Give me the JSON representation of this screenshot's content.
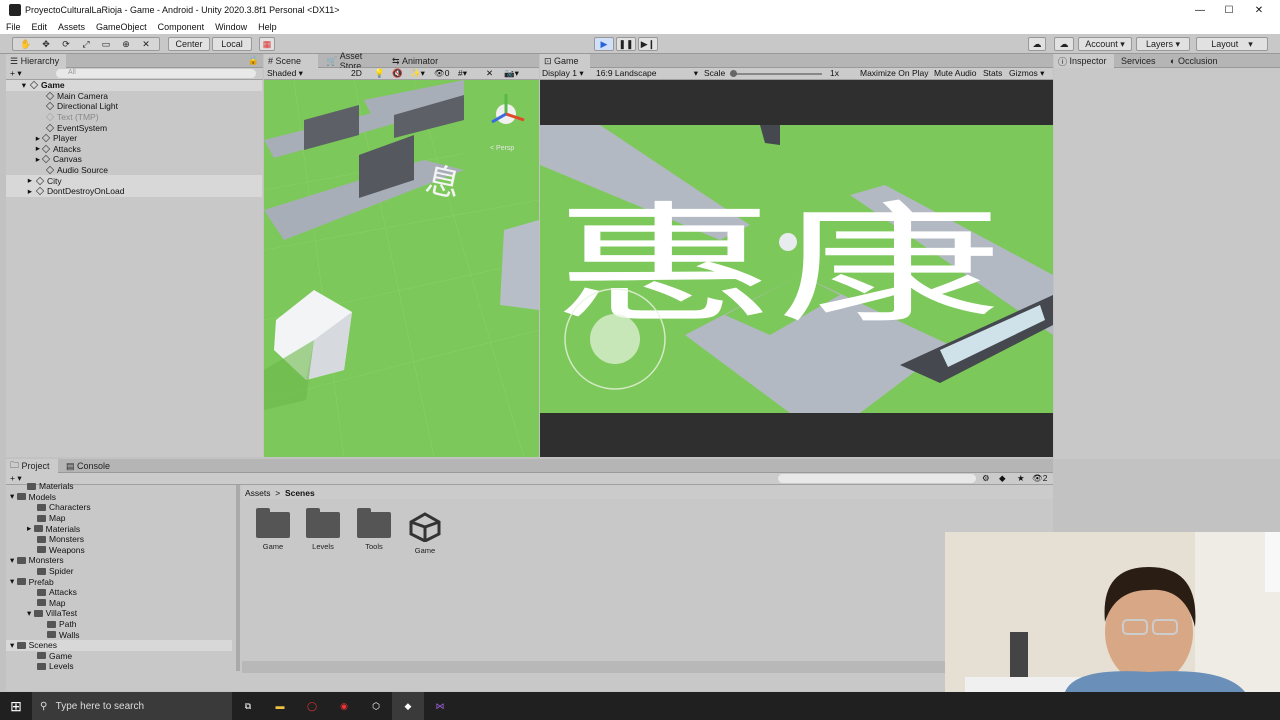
{
  "window": {
    "title": "ProyectoCulturalLaRioja - Game - Android - Unity 2020.3.8f1 Personal <DX11>",
    "minimize": "—",
    "maximize": "☐",
    "close": "✕"
  },
  "menu": [
    "File",
    "Edit",
    "Assets",
    "GameObject",
    "Component",
    "Window",
    "Help"
  ],
  "toolbar": {
    "center": "Center",
    "local": "Local",
    "account": "Account",
    "layers": "Layers",
    "layout": "Layout"
  },
  "hierarchy": {
    "tab": "Hierarchy",
    "search": "All",
    "items": [
      {
        "label": "Game",
        "depth": 0,
        "bold": true
      },
      {
        "label": "Main Camera",
        "depth": 1
      },
      {
        "label": "Directional Light",
        "depth": 1
      },
      {
        "label": "Text (TMP)",
        "depth": 1,
        "disabled": true
      },
      {
        "label": "EventSystem",
        "depth": 1
      },
      {
        "label": "Player",
        "depth": 1
      },
      {
        "label": "Attacks",
        "depth": 1
      },
      {
        "label": "Canvas",
        "depth": 1
      },
      {
        "label": "Audio Source",
        "depth": 1
      },
      {
        "label": "City",
        "depth": 0
      },
      {
        "label": "DontDestroyOnLoad",
        "depth": 0
      }
    ]
  },
  "scene": {
    "tabs": [
      "Scene",
      "Asset Store",
      "Animator"
    ],
    "shading": "Shaded",
    "mode2d": "2D",
    "persp": "< Persp"
  },
  "game": {
    "tab": "Game",
    "display": "Display 1",
    "aspect": "16:9 Landscape",
    "scale_label": "Scale",
    "scale_value": "1x",
    "buttons": [
      "Maximize On Play",
      "Mute Audio",
      "Stats",
      "Gizmos"
    ],
    "overlay_text": "惠康"
  },
  "inspector": {
    "tabs": [
      "Inspector",
      "Services",
      "Occlusion"
    ]
  },
  "project": {
    "tabs": [
      "Project",
      "Console"
    ],
    "breadcrumb": [
      "Assets",
      "Scenes"
    ],
    "tree": [
      {
        "label": "Materials",
        "depth": 1
      },
      {
        "label": "Models",
        "depth": 0
      },
      {
        "label": "Characters",
        "depth": 1
      },
      {
        "label": "Map",
        "depth": 1
      },
      {
        "label": "Materials",
        "depth": 1
      },
      {
        "label": "Monsters",
        "depth": 1
      },
      {
        "label": "Weapons",
        "depth": 1
      },
      {
        "label": "Monsters",
        "depth": 0
      },
      {
        "label": "Spider",
        "depth": 1
      },
      {
        "label": "Prefab",
        "depth": 0
      },
      {
        "label": "Attacks",
        "depth": 1
      },
      {
        "label": "Map",
        "depth": 1
      },
      {
        "label": "VillaTest",
        "depth": 1
      },
      {
        "label": "Path",
        "depth": 2
      },
      {
        "label": "Walls",
        "depth": 2
      },
      {
        "label": "Scenes",
        "depth": 0
      },
      {
        "label": "Game",
        "depth": 1
      },
      {
        "label": "Levels",
        "depth": 1
      }
    ],
    "assets": [
      {
        "label": "Game",
        "kind": "folder"
      },
      {
        "label": "Levels",
        "kind": "folder"
      },
      {
        "label": "Tools",
        "kind": "folder"
      },
      {
        "label": "Game",
        "kind": "unity-scene"
      }
    ],
    "count_label": "2"
  },
  "taskbar": {
    "search": "Type here to search"
  },
  "colors": {
    "grass": "#7cc85a",
    "dark": "#2f2f2f",
    "play_active": "#5a8fe0"
  }
}
